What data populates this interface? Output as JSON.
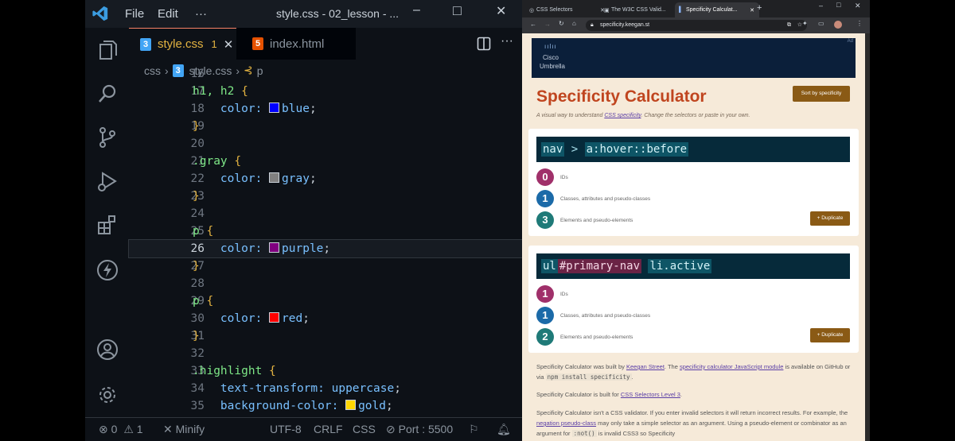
{
  "vscode": {
    "menu": [
      "File",
      "Edit",
      "···"
    ],
    "window_title": "style.css - 02_lesson - ...",
    "tabs": [
      {
        "label": "style.css",
        "badge": "1",
        "close": "✕",
        "icon": "css-file-icon"
      },
      {
        "label": "index.html",
        "icon": "html-file-icon"
      }
    ],
    "breadcrumb": [
      "css",
      "style.css",
      "p"
    ],
    "code_lines": [
      {
        "n": "16",
        "tokens": []
      },
      {
        "n": "17",
        "tokens": [
          {
            "t": "h1, h2 ",
            "c": "sel"
          },
          {
            "t": "{",
            "c": "brace"
          }
        ]
      },
      {
        "n": "18",
        "tokens": [
          {
            "t": "    color: ",
            "c": "prop"
          },
          {
            "t": "",
            "c": "swatch",
            "color": "#0000ff"
          },
          {
            "t": "blue",
            "c": "val"
          },
          {
            "t": ";",
            "c": "punc"
          }
        ]
      },
      {
        "n": "19",
        "tokens": [
          {
            "t": "}",
            "c": "brace"
          }
        ]
      },
      {
        "n": "20",
        "tokens": []
      },
      {
        "n": "21",
        "tokens": [
          {
            "t": ".gray ",
            "c": "sel"
          },
          {
            "t": "{",
            "c": "brace"
          }
        ]
      },
      {
        "n": "22",
        "tokens": [
          {
            "t": "    color: ",
            "c": "prop"
          },
          {
            "t": "",
            "c": "swatch",
            "color": "#808080"
          },
          {
            "t": "gray",
            "c": "val"
          },
          {
            "t": ";",
            "c": "punc"
          }
        ]
      },
      {
        "n": "23",
        "tokens": [
          {
            "t": "}",
            "c": "brace"
          }
        ]
      },
      {
        "n": "24",
        "tokens": []
      },
      {
        "n": "25",
        "tokens": [
          {
            "t": "p ",
            "c": "sel"
          },
          {
            "t": "{",
            "c": "brace"
          }
        ]
      },
      {
        "n": "26",
        "tokens": [
          {
            "t": "    color: ",
            "c": "prop"
          },
          {
            "t": "",
            "c": "swatch",
            "color": "#800080"
          },
          {
            "t": "purple",
            "c": "val"
          },
          {
            "t": ";",
            "c": "punc"
          }
        ],
        "current": true
      },
      {
        "n": "27",
        "tokens": [
          {
            "t": "}",
            "c": "brace"
          }
        ]
      },
      {
        "n": "28",
        "tokens": []
      },
      {
        "n": "29",
        "tokens": [
          {
            "t": "p ",
            "c": "sel"
          },
          {
            "t": "{",
            "c": "brace"
          }
        ]
      },
      {
        "n": "30",
        "tokens": [
          {
            "t": "    color: ",
            "c": "prop"
          },
          {
            "t": "",
            "c": "swatch",
            "color": "#ff0000"
          },
          {
            "t": "red",
            "c": "val"
          },
          {
            "t": ";",
            "c": "punc"
          }
        ]
      },
      {
        "n": "31",
        "tokens": [
          {
            "t": "}",
            "c": "brace"
          }
        ]
      },
      {
        "n": "32",
        "tokens": []
      },
      {
        "n": "33",
        "tokens": [
          {
            "t": ".highlight ",
            "c": "sel"
          },
          {
            "t": "{",
            "c": "brace"
          }
        ]
      },
      {
        "n": "34",
        "tokens": [
          {
            "t": "    text-transform: ",
            "c": "prop"
          },
          {
            "t": "uppercase",
            "c": "val"
          },
          {
            "t": ";",
            "c": "punc"
          }
        ]
      },
      {
        "n": "35",
        "tokens": [
          {
            "t": "    background-color: ",
            "c": "prop"
          },
          {
            "t": "",
            "c": "swatch",
            "color": "#ffd700"
          },
          {
            "t": "gold",
            "c": "val"
          },
          {
            "t": ";",
            "c": "punc"
          }
        ]
      }
    ],
    "status": {
      "errors": "0",
      "warnings": "1",
      "minify": "Minify",
      "encoding": "UTF-8",
      "eol": "CRLF",
      "language": "CSS",
      "port": "Port : 5500"
    },
    "accent": "#e3b341"
  },
  "browser": {
    "tabs": [
      "CSS Selectors",
      "The W3C CSS Valid...",
      "Specificity Calculat..."
    ],
    "url": "specificity.keegan.st",
    "ad": {
      "brand": "Cisco",
      "product": "Umbrella",
      "label": "Ad"
    },
    "title": "Specificity Calculator",
    "sort_button": "Sort by specificity",
    "subtitle_before": "A visual way to understand ",
    "subtitle_link": "CSS specificity",
    "subtitle_after": ". Change the selectors or paste in your own.",
    "cards": [
      {
        "selector_parts": [
          {
            "t": "nav",
            "k": "el"
          },
          {
            "t": " > ",
            "k": "plain"
          },
          {
            "t": "a:hover::before",
            "k": "el"
          }
        ],
        "counts": [
          {
            "value": "0",
            "label": "IDs",
            "color": "#a0306a"
          },
          {
            "value": "1",
            "label": "Classes, attributes and pseudo-classes",
            "color": "#1b6aa8"
          },
          {
            "value": "3",
            "label": "Elements and pseudo-elements",
            "color": "#1f7a78"
          }
        ],
        "duplicate": "+ Duplicate"
      },
      {
        "selector_parts": [
          {
            "t": "ul",
            "k": "el"
          },
          {
            "t": "#primary-nav",
            "k": "id"
          },
          {
            "t": " ",
            "k": "plain"
          },
          {
            "t": "li.active",
            "k": "el"
          }
        ],
        "counts": [
          {
            "value": "1",
            "label": "IDs",
            "color": "#a0306a"
          },
          {
            "value": "1",
            "label": "Classes, attributes and pseudo-classes",
            "color": "#1b6aa8"
          },
          {
            "value": "2",
            "label": "Elements and pseudo-elements",
            "color": "#1f7a78"
          }
        ],
        "duplicate": "+ Duplicate"
      }
    ],
    "footer": {
      "p1_a": "Specificity Calculator was built by ",
      "p1_link1": "Keegan Street",
      "p1_b": ". The ",
      "p1_link2": "specificity calculator JavaScript module",
      "p1_c": " is available on GitHub or via ",
      "p1_code": "npm install specificity",
      "p1_d": ".",
      "p2_a": "Specificity Calculator is built for ",
      "p2_link": "CSS Selectors Level 3",
      "p2_b": ".",
      "p3_a": "Specificity Calculator isn't a CSS validator. If you enter invalid selectors it will return incorrect results. For example, the ",
      "p3_link": "negation pseudo-class",
      "p3_b": " may only take a simple selector as an argument. Using a pseudo-element or combinator as an argument for ",
      "p3_code": ":not()",
      "p3_c": " is invalid CSS3 so Specificity"
    },
    "title_color": "#c0451f"
  }
}
